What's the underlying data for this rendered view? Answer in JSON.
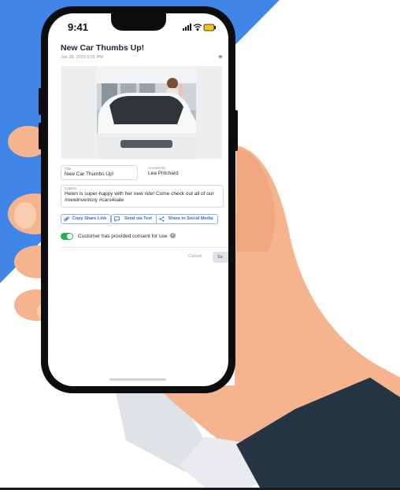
{
  "status_bar": {
    "time": "9:41"
  },
  "post": {
    "title": "New Car Thumbs Up!",
    "date": "Jun 28, 2023  6:31 PM"
  },
  "fields": {
    "title_label": "Title",
    "title_value": "New Car Thumbs Up!",
    "created_by_label": "Created By",
    "created_by_value": "Lea Pritchard",
    "caption_label": "Caption",
    "caption_value": "Helen is super-happy with her new ride! Come check out all of our #newinventory #cars4sale"
  },
  "actions": {
    "copy_link": "Copy Share Link",
    "send_text": "Send via Text",
    "share_social": "Share to Social Media"
  },
  "consent": {
    "label": "Customer has provided consent for use",
    "enabled": true,
    "info_glyph": "i"
  },
  "footer": {
    "cancel": "Cancel",
    "save": "Sa"
  },
  "colors": {
    "accent": "#2f6fd6",
    "toggle_on": "#22b24c",
    "background_blue": "#3f86e8",
    "skin": "#f5b48e",
    "sleeve": "#263545"
  }
}
